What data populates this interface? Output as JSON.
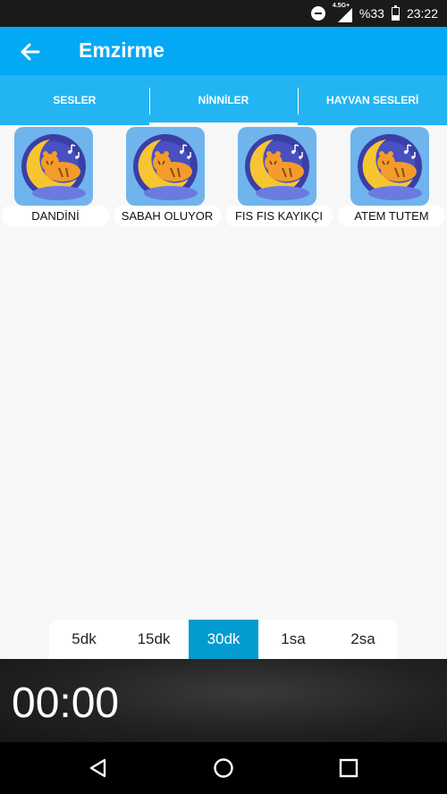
{
  "status_bar": {
    "network_type": "4.5G+",
    "battery_percent": "%33",
    "time": "23:22",
    "icons": [
      "do-not-disturb-icon",
      "signal-icon",
      "battery-icon"
    ]
  },
  "app_bar": {
    "title": "Emzirme",
    "back_icon": "arrow-left-icon",
    "color": "#03a9f4"
  },
  "tabs": [
    {
      "label": "SESLER",
      "active": false
    },
    {
      "label": "NİNNİLER",
      "active": true
    },
    {
      "label": "HAYVAN SESLERİ",
      "active": false
    }
  ],
  "lullabies": [
    {
      "title": "DANDİNİ",
      "icon": "moon-tiger-icon"
    },
    {
      "title": "SABAH OLUYOR",
      "icon": "moon-tiger-icon"
    },
    {
      "title": "FIS FIS KAYIKÇI",
      "icon": "moon-tiger-icon"
    },
    {
      "title": "ATEM TUTEM",
      "icon": "moon-tiger-icon"
    }
  ],
  "timer": {
    "options": [
      "5dk",
      "15dk",
      "30dk",
      "1sa",
      "2sa"
    ],
    "selected": "30dk",
    "accent": "#039bd0"
  },
  "player": {
    "elapsed": "00:00"
  },
  "nav_bar": {
    "icons": [
      "back-triangle-icon",
      "home-circle-icon",
      "recents-square-icon"
    ]
  }
}
